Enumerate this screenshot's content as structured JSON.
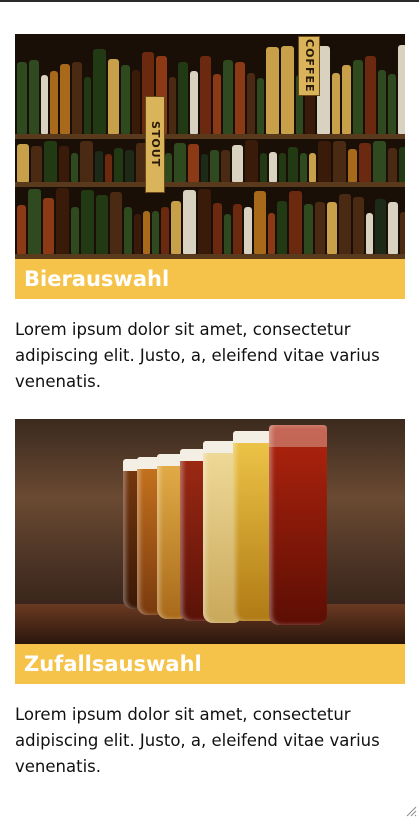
{
  "cards": [
    {
      "title": "Bierauswahl",
      "text": "Lorem ipsum dolor sit amet, consectetur adipiscing elit. Justo, a, eleifend vitae varius venenatis."
    },
    {
      "title": "Zufallsauswahl",
      "text": "Lorem ipsum dolor sit amet, consectetur adipiscing elit. Justo, a, eleifend vitae varius venenatis."
    }
  ],
  "photo1_signs": [
    "STOUT",
    "COFFEE"
  ],
  "colors": {
    "caption_bg": "#f6c34a",
    "caption_text": "#ffffff",
    "body_text": "#111111"
  }
}
